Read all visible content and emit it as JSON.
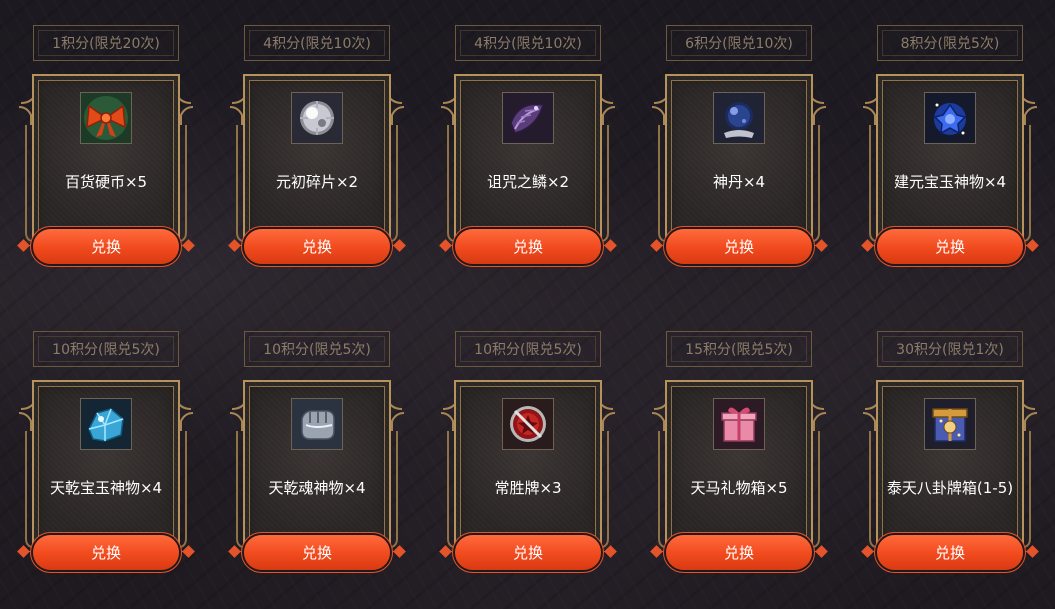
{
  "items": [
    {
      "cost": "1积分(限兑20次)",
      "name": "百货硬币×5",
      "icon": "bow-coin-icon",
      "button": "兑换"
    },
    {
      "cost": "4积分(限兑10次)",
      "name": "元初碎片×2",
      "icon": "silver-orb-icon",
      "button": "兑换"
    },
    {
      "cost": "4积分(限兑10次)",
      "name": "诅咒之鳞×2",
      "icon": "cursed-scale-icon",
      "button": "兑换"
    },
    {
      "cost": "6积分(限兑10次)",
      "name": "神丹×4",
      "icon": "divine-pill-icon",
      "button": "兑换"
    },
    {
      "cost": "8积分(限兑5次)",
      "name": "建元宝玉神物×4",
      "icon": "blue-rose-gem-icon",
      "button": "兑换"
    },
    {
      "cost": "10积分(限兑5次)",
      "name": "天乾宝玉神物×4",
      "icon": "ice-gem-icon",
      "button": "兑换"
    },
    {
      "cost": "10积分(限兑5次)",
      "name": "天乾魂神物×4",
      "icon": "silver-fist-icon",
      "button": "兑换"
    },
    {
      "cost": "10积分(限兑5次)",
      "name": "常胜牌×3",
      "icon": "red-medal-icon",
      "button": "兑换"
    },
    {
      "cost": "15积分(限兑5次)",
      "name": "天马礼物箱×5",
      "icon": "pink-gift-box-icon",
      "button": "兑换"
    },
    {
      "cost": "30积分(限兑1次)",
      "name": "泰天八卦牌箱(1-5)",
      "icon": "bagua-chest-icon",
      "button": "兑换"
    }
  ],
  "colors": {
    "button": "#f04a1e",
    "frame_gold": "#b7935c",
    "cost_text": "#8c7d6a"
  }
}
